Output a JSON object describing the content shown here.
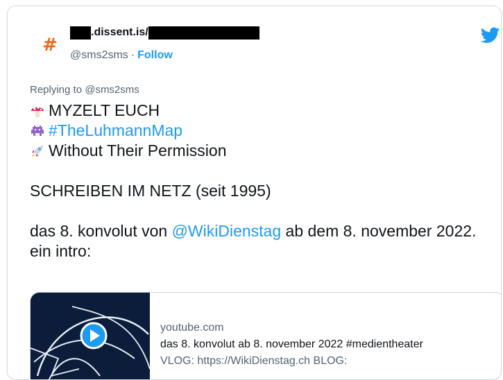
{
  "tweet": {
    "author": {
      "name_suffix": ".dissent.is/",
      "handle": "@sms2sms",
      "separator": "·",
      "follow_label": "Follow",
      "avatar_glyph": "#",
      "avatar_color": "#f4681f"
    },
    "replying_to": "Replying to @sms2sms",
    "lines": {
      "line1": "MYZELT EUCH",
      "line2": "#TheLuhmannMap",
      "line3": "Without Their Permission",
      "line4": "SCHREIBEN IM NETZ (seit 1995)",
      "line5_pre": "das 8. konvolut von ",
      "line5_mention": "@WikiDienstag",
      "line5_post": " ab dem 8. november 2022. ein intro:"
    },
    "link_card": {
      "domain": "youtube.com",
      "title": "das 8. konvolut ab 8. november 2022 #medientheater",
      "description": "VLOG: https://WikiDienstag.ch BLOG:"
    }
  },
  "colors": {
    "accent": "#1d9bf0",
    "text": "#0f1419",
    "muted": "#536471",
    "border": "#cfd9de"
  },
  "icons": {
    "logo": "twitter-bird-icon",
    "emoji1": "mushroom-icon",
    "emoji2": "space-invader-icon",
    "emoji3": "rocket-icon",
    "play": "play-icon"
  }
}
